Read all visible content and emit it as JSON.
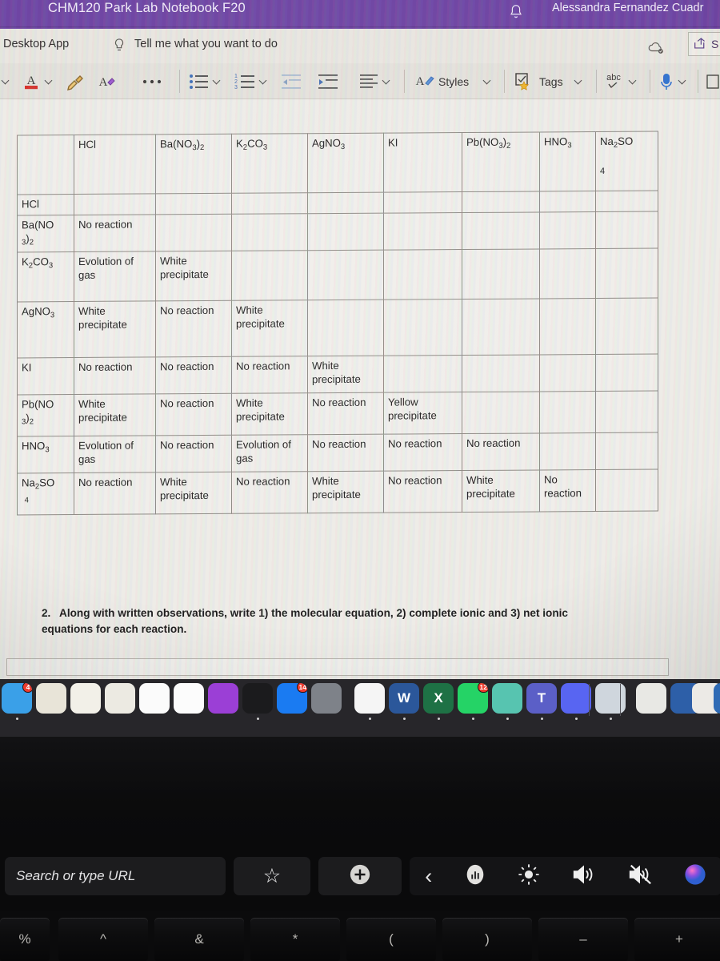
{
  "titlebar": {
    "notebook_title": "CHM120 Park Lab Notebook F20",
    "user_name": "Alessandra Fernandez Cuadr",
    "bell_icon": "bell-icon",
    "accent_color": "#6f45a3"
  },
  "tellbar": {
    "desktop_app": "Desktop App",
    "bulb_icon": "lightbulb-icon",
    "tell_me": "Tell me what you want to do",
    "cloud_icon": "cloud-saved-icon",
    "share_label": "S",
    "share_icon": "share-icon"
  },
  "ribbon": {
    "items": [
      {
        "name": "font-size-dropdown-chevron",
        "icon": "chevron-down-icon",
        "label": ""
      },
      {
        "name": "font-color-button",
        "icon": "font-color-a-icon",
        "label": ""
      },
      {
        "name": "font-color-chevron",
        "icon": "chevron-down-icon",
        "label": ""
      },
      {
        "name": "format-painter-button",
        "icon": "format-painter-icon",
        "label": ""
      },
      {
        "name": "clear-formatting-button",
        "icon": "clear-formatting-icon",
        "label": ""
      },
      {
        "name": "more-commands-button",
        "icon": "ellipsis-icon",
        "label": ""
      },
      {
        "name": "bullet-list-button",
        "icon": "bulleted-list-icon",
        "label": ""
      },
      {
        "name": "bullet-list-chevron",
        "icon": "chevron-down-icon",
        "label": ""
      },
      {
        "name": "numbered-list-button",
        "icon": "numbered-list-icon",
        "label": ""
      },
      {
        "name": "numbered-list-chevron",
        "icon": "chevron-down-icon",
        "label": ""
      },
      {
        "name": "decrease-indent-button",
        "icon": "decrease-indent-icon",
        "label": ""
      },
      {
        "name": "increase-indent-button",
        "icon": "increase-indent-icon",
        "label": ""
      },
      {
        "name": "align-button",
        "icon": "align-left-icon",
        "label": ""
      },
      {
        "name": "align-chevron",
        "icon": "chevron-down-icon",
        "label": ""
      },
      {
        "name": "styles-button",
        "icon": "styles-pen-icon",
        "label": "Styles"
      },
      {
        "name": "styles-chevron",
        "icon": "chevron-down-icon",
        "label": ""
      },
      {
        "name": "tags-button",
        "icon": "tags-star-checkbox-icon",
        "label": "Tags"
      },
      {
        "name": "tags-chevron",
        "icon": "chevron-down-icon",
        "label": ""
      },
      {
        "name": "spelling-button",
        "icon": "abc-spellcheck-icon",
        "label": ""
      },
      {
        "name": "spelling-chevron",
        "icon": "chevron-down-icon",
        "label": ""
      },
      {
        "name": "dictate-button",
        "icon": "microphone-icon",
        "label": ""
      },
      {
        "name": "dictate-chevron",
        "icon": "chevron-down-icon",
        "label": ""
      },
      {
        "name": "insert-button",
        "icon": "page-icon",
        "label": ""
      }
    ],
    "styles_label": "Styles",
    "tags_label": "Tags",
    "abc_label": "abc"
  },
  "table": {
    "columns": [
      "",
      "HCl",
      "Ba(NO3)2",
      "K2CO3",
      "AgNO3",
      "KI",
      "Pb(NO3)2",
      "HNO3",
      "Na2SO4"
    ],
    "column_html": [
      "",
      "HCl",
      "Ba(NO<sub>3</sub>)<sub>2</sub>",
      "K<sub>2</sub>CO<sub>3</sub>",
      "AgNO<sub>3</sub>",
      "KI",
      "Pb(NO<sub>3</sub>)<sub>2</sub>",
      "HNO<sub>3</sub>",
      "Na<sub>2</sub>SO"
    ],
    "last_col_wrap": "4",
    "rows": [
      {
        "header": "HCl",
        "header_html": "HCl",
        "cells": [
          "",
          "",
          "",
          "",
          "",
          "",
          "",
          ""
        ]
      },
      {
        "header": "Ba(NO3)2",
        "header_html": "Ba(NO<br><sub>3</sub>)<sub>2</sub>",
        "cells": [
          "No reaction",
          "",
          "",
          "",
          "",
          "",
          "",
          ""
        ]
      },
      {
        "header": "K2CO3",
        "header_html": "K<sub>2</sub>CO<sub>3</sub>",
        "cells": [
          "Evolution of gas",
          "White precipitate",
          "",
          "",
          "",
          "",
          "",
          ""
        ]
      },
      {
        "header": "AgNO3",
        "header_html": "AgNO<sub>3</sub>",
        "cells": [
          "White precipitate",
          "No reaction",
          "White precipitate",
          "",
          "",
          "",
          "",
          ""
        ]
      },
      {
        "header": "KI",
        "header_html": "KI",
        "cells": [
          "No reaction",
          "No reaction",
          "No reaction",
          "White precipitate",
          "",
          "",
          "",
          ""
        ]
      },
      {
        "header": "Pb(NO3)2",
        "header_html": "Pb(NO<br><sub>3</sub>)<sub>2</sub>",
        "cells": [
          "White precipitate",
          "No reaction",
          "White precipitate",
          "No reaction",
          "Yellow precipitate",
          "",
          "",
          ""
        ]
      },
      {
        "header": "HNO3",
        "header_html": "HNO<sub>3</sub>",
        "cells": [
          "Evolution of gas",
          "No reaction",
          "Evolution of gas",
          "No reaction",
          "No reaction",
          "No reaction",
          "",
          ""
        ]
      },
      {
        "header": "Na2SO4",
        "header_html": "Na<sub>2</sub>SO<br>&nbsp;<sub>4</sub>",
        "cells": [
          "No reaction",
          "White precipitate",
          "No reaction",
          "White precipitate",
          "No reaction",
          "White precipitate",
          "No reaction",
          ""
        ]
      }
    ]
  },
  "question": {
    "number": "2.",
    "text": "Along with written observations, write 1) the molecular equation, 2) complete ionic and 3) net ionic equations for each reaction."
  },
  "dock": {
    "items": [
      {
        "name": "finder",
        "label": "",
        "color": "#3aa0e8",
        "badge": "4",
        "running": true
      },
      {
        "name": "keynote-document",
        "label": "",
        "color": "#e8e4d8",
        "badge": "",
        "running": false
      },
      {
        "name": "numbers",
        "label": "",
        "color": "#f2f0e8",
        "badge": "",
        "running": false
      },
      {
        "name": "keynote",
        "label": "",
        "color": "#eceae2",
        "badge": "",
        "running": false
      },
      {
        "name": "news",
        "label": "",
        "color": "#fbfbfb",
        "badge": "",
        "running": false
      },
      {
        "name": "music",
        "label": "",
        "color": "#fcfcfc",
        "badge": "",
        "running": false
      },
      {
        "name": "podcasts",
        "label": "",
        "color": "#9b3fd6",
        "badge": "",
        "running": false
      },
      {
        "name": "apple-tv",
        "label": "",
        "color": "#1b1b1d",
        "badge": "",
        "running": true
      },
      {
        "name": "app-store",
        "label": "",
        "color": "#1a7bf2",
        "badge": "14",
        "running": false
      },
      {
        "name": "system-preferences",
        "label": "",
        "color": "#7e8289",
        "badge": "",
        "running": false
      },
      {
        "name": "chrome",
        "label": "",
        "color": "#f5f5f5",
        "badge": "",
        "running": true
      },
      {
        "name": "word",
        "label": "W",
        "color": "#2b579a",
        "badge": "",
        "running": true
      },
      {
        "name": "excel",
        "label": "X",
        "color": "#1e7145",
        "badge": "",
        "running": true
      },
      {
        "name": "whatsapp",
        "label": "",
        "color": "#25d366",
        "badge": "12",
        "running": true
      },
      {
        "name": "onenote-class",
        "label": "",
        "color": "#57c4b0",
        "badge": "",
        "running": true
      },
      {
        "name": "microsoft-teams",
        "label": "T",
        "color": "#5b5fc7",
        "badge": "",
        "running": true
      },
      {
        "name": "discord",
        "label": "",
        "color": "#5865f2",
        "badge": "",
        "running": true
      },
      {
        "name": "photos-stack",
        "label": "",
        "color": "#cfd6dd",
        "badge": "",
        "running": true
      },
      {
        "name": "document-window",
        "label": "",
        "color": "#e8e8e4",
        "badge": "",
        "running": false
      },
      {
        "name": "minimized-window-1",
        "label": "",
        "color": "#2d5fa8",
        "badge": "",
        "running": false
      },
      {
        "name": "minimized-window-2",
        "label": "",
        "color": "#eceae6",
        "badge": "",
        "running": false
      },
      {
        "name": "minimized-window-3",
        "label": "",
        "color": "#2f6bb5",
        "badge": "",
        "running": false
      },
      {
        "name": "minimized-window-4",
        "label": "",
        "color": "#e3e1dd",
        "badge": "",
        "running": false
      },
      {
        "name": "trash",
        "label": "",
        "color": "#4a4a4e",
        "badge": "",
        "running": false
      }
    ]
  },
  "touchbar": {
    "url_placeholder": "Search or type URL",
    "keys": [
      {
        "name": "bookmark",
        "icon": "star-icon",
        "label": "☆"
      },
      {
        "name": "new-tab",
        "icon": "plus-circle-icon",
        "label": "+"
      },
      {
        "name": "expand-control-strip",
        "icon": "chevron-left-icon",
        "label": "‹"
      },
      {
        "name": "siri",
        "icon": "siri-waveform-icon",
        "label": ""
      },
      {
        "name": "brightness",
        "icon": "brightness-icon",
        "label": ""
      },
      {
        "name": "volume-up",
        "icon": "speaker-on-icon",
        "label": ""
      },
      {
        "name": "mute",
        "icon": "speaker-mute-icon",
        "label": ""
      },
      {
        "name": "siri-orb",
        "icon": "siri-orb-icon",
        "label": ""
      }
    ]
  },
  "keyboard": {
    "keys": [
      "%",
      "^",
      "&",
      "*",
      "(",
      ")",
      "–",
      "+"
    ]
  }
}
